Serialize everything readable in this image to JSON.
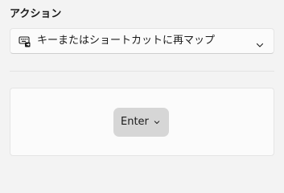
{
  "action": {
    "label": "アクション",
    "selected_option": "キーまたはショートカットに再マップ",
    "option_icon": "keyboard-remap-icon",
    "expand_icon": "chevron-down-icon"
  },
  "key": {
    "label": "Enter",
    "expand_icon": "chevron-down-icon"
  }
}
